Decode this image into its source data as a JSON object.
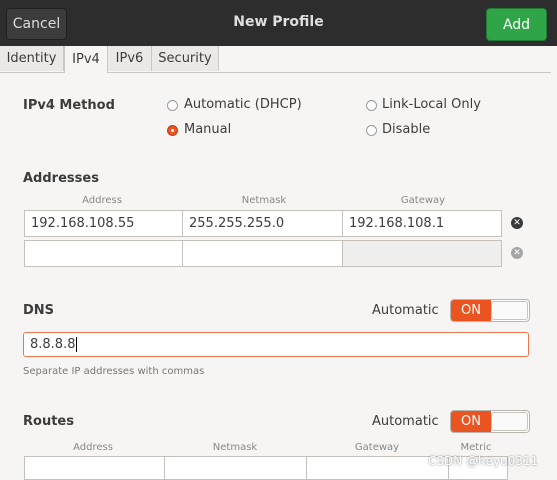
{
  "header": {
    "cancel": "Cancel",
    "title": "New Profile",
    "add": "Add"
  },
  "tabs": [
    "Identity",
    "IPv4",
    "IPv6",
    "Security"
  ],
  "method": {
    "label": "IPv4 Method",
    "options": [
      "Automatic (DHCP)",
      "Link-Local Only",
      "Manual",
      "Disable"
    ],
    "selected": "Manual"
  },
  "addresses": {
    "label": "Addresses",
    "cols": [
      "Address",
      "Netmask",
      "Gateway"
    ],
    "row1": [
      "192.168.108.55",
      "255.255.255.0",
      "192.168.108.1"
    ],
    "row2": [
      "",
      "",
      ""
    ]
  },
  "dns": {
    "label": "DNS",
    "auto_label": "Automatic",
    "toggle": "ON",
    "value": "8.8.8.8",
    "hint": "Separate IP addresses with commas"
  },
  "routes": {
    "label": "Routes",
    "auto_label": "Automatic",
    "toggle": "ON",
    "cols": [
      "Address",
      "Netmask",
      "Gateway",
      "Metric"
    ]
  },
  "watermark": "CSDN @heyu0311",
  "colors": {
    "accent": "#e95420",
    "add_button": "#2fa548",
    "titlebar": "#2d2d2d"
  }
}
